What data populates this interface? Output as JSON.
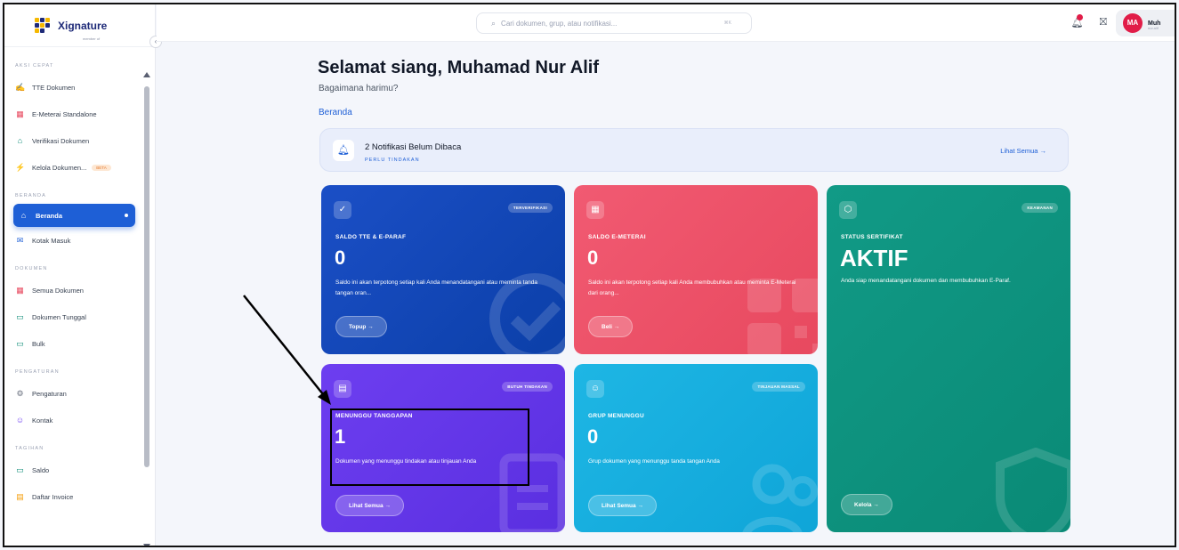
{
  "brand": {
    "name": "Xignature",
    "sub": "member of"
  },
  "sidebar": {
    "sections": [
      {
        "title": "AKSI CEPAT",
        "items": [
          {
            "label": "TTE Dokumen",
            "icon": "signature-icon"
          },
          {
            "label": "E-Meterai Standalone",
            "icon": "grid-icon"
          },
          {
            "label": "Verifikasi Dokumen",
            "icon": "lock-icon"
          },
          {
            "label": "Kelola Dokumen...",
            "icon": "bolt-icon",
            "badge": "BETA"
          }
        ]
      },
      {
        "title": "BERANDA",
        "items": [
          {
            "label": "Beranda",
            "icon": "home-icon",
            "active": true
          },
          {
            "label": "Kotak Masuk",
            "icon": "mail-icon"
          }
        ]
      },
      {
        "title": "DOKUMEN",
        "items": [
          {
            "label": "Semua Dokumen",
            "icon": "grid-icon"
          },
          {
            "label": "Dokumen Tunggal",
            "icon": "folder-icon"
          },
          {
            "label": "Bulk",
            "icon": "folder-icon"
          }
        ]
      },
      {
        "title": "PENGATURAN",
        "items": [
          {
            "label": "Pengaturan",
            "icon": "gear-icon"
          },
          {
            "label": "Kontak",
            "icon": "users-icon"
          }
        ]
      },
      {
        "title": "TAGIHAN",
        "items": [
          {
            "label": "Saldo",
            "icon": "card-icon"
          },
          {
            "label": "Daftar Invoice",
            "icon": "invoice-icon"
          }
        ]
      }
    ]
  },
  "topbar": {
    "search_placeholder": "Cari dokumen, grup, atau notifikasi...",
    "shortcut": "⌘K",
    "user_initials": "MA",
    "user_name": "Muh",
    "user_email": "nur.alif"
  },
  "main": {
    "greeting": "Selamat siang, Muhamad Nur Alif",
    "greeting_sub": "Bagaimana harimu?",
    "breadcrumb": "Beranda",
    "notification": {
      "title": "2 Notifikasi Belum Dibaca",
      "sub": "PERLU TINDAKAN",
      "link": "Lihat Semua  →"
    },
    "cards": {
      "tte": {
        "badge": "TERVERIFIKASI",
        "label": "SALDO TTE & E-PARAF",
        "value": "0",
        "desc": "Saldo ini akan terpotong setiap kali Anda menandatangani atau meminta tanda tangan oran...",
        "button": "Topup  →"
      },
      "meterai": {
        "badge": "",
        "label": "SALDO E-METERAI",
        "value": "0",
        "desc": "Saldo ini akan terpotong setiap kali Anda membubuhkan atau meminta E-Meterai dari orang...",
        "button": "Beli  →"
      },
      "sertifikat": {
        "badge": "KEAMANAN",
        "label": "STATUS SERTIFIKAT",
        "value": "AKTIF",
        "desc": "Anda siap menandatangani dokumen dan membubuhkan E-Paraf.",
        "button": "Kelola  →"
      },
      "menunggu": {
        "badge": "BUTUH TINDAKAN",
        "label": "MENUNGGU TANGGAPAN",
        "value": "1",
        "desc": "Dokumen yang menunggu tindakan atau tinjauan Anda",
        "button": "Lihat Semua  →"
      },
      "grup": {
        "badge": "TINJAUAN MASSAL",
        "label": "GRUP MENUNGGU",
        "value": "0",
        "desc": "Grup dokumen yang menunggu tanda tangan Anda",
        "button": "Lihat Semua  →"
      }
    }
  },
  "colors": {
    "primary": "#1e5fd6",
    "tte": "#0b3fa8",
    "meterai": "#e8495f",
    "sertifikat": "#0a8a76",
    "menunggu": "#5a2fe0",
    "grup": "#0fa5d8"
  }
}
